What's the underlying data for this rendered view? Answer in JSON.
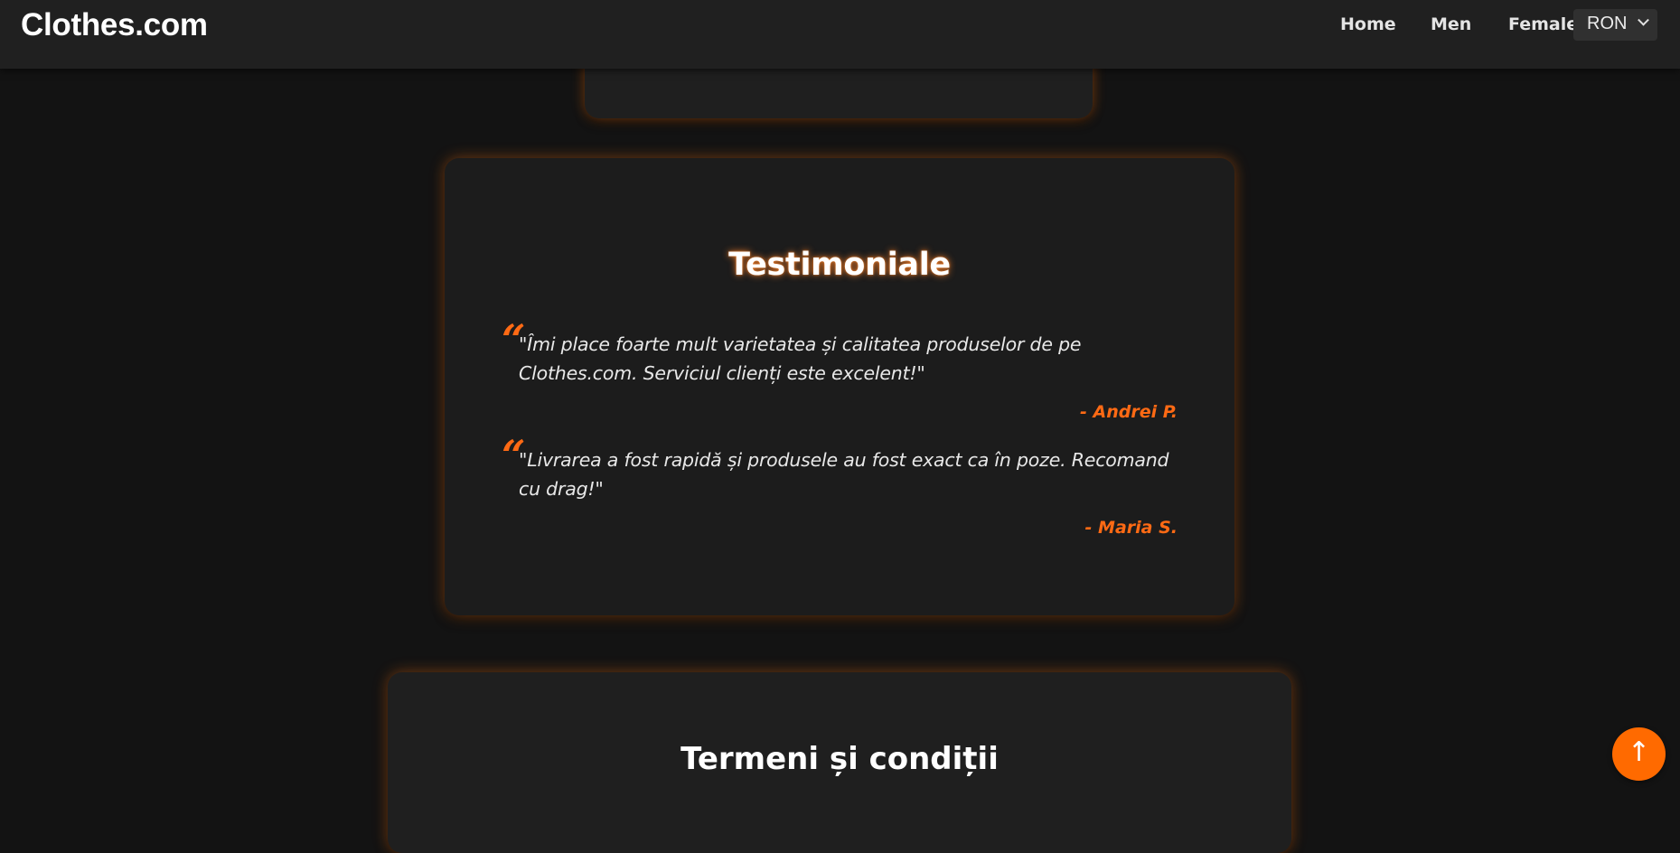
{
  "header": {
    "brand": "Clothes.com",
    "nav": {
      "home": "Home",
      "men": "Men",
      "female": "Female"
    },
    "currency_selected": "RON"
  },
  "testimonials": {
    "title": "Testimoniale",
    "items": [
      {
        "quote": "\"Îmi place foarte mult varietatea și calitatea produselor de pe Clothes.com. Serviciul clienți este excelent!\"",
        "author": "- Andrei P."
      },
      {
        "quote": "\"Livrarea a fost rapidă și produsele au fost exact ca în poze. Recomand cu drag!\"",
        "author": "- Maria S."
      }
    ]
  },
  "terms": {
    "title": "Termeni și condiții"
  },
  "scroll_top": {
    "glyph": "↑",
    "icon": "arrow-up-icon"
  },
  "colors": {
    "accent": "#ff6a14",
    "background": "#131313",
    "card": "#1c1c1c",
    "navbar": "#202020"
  }
}
